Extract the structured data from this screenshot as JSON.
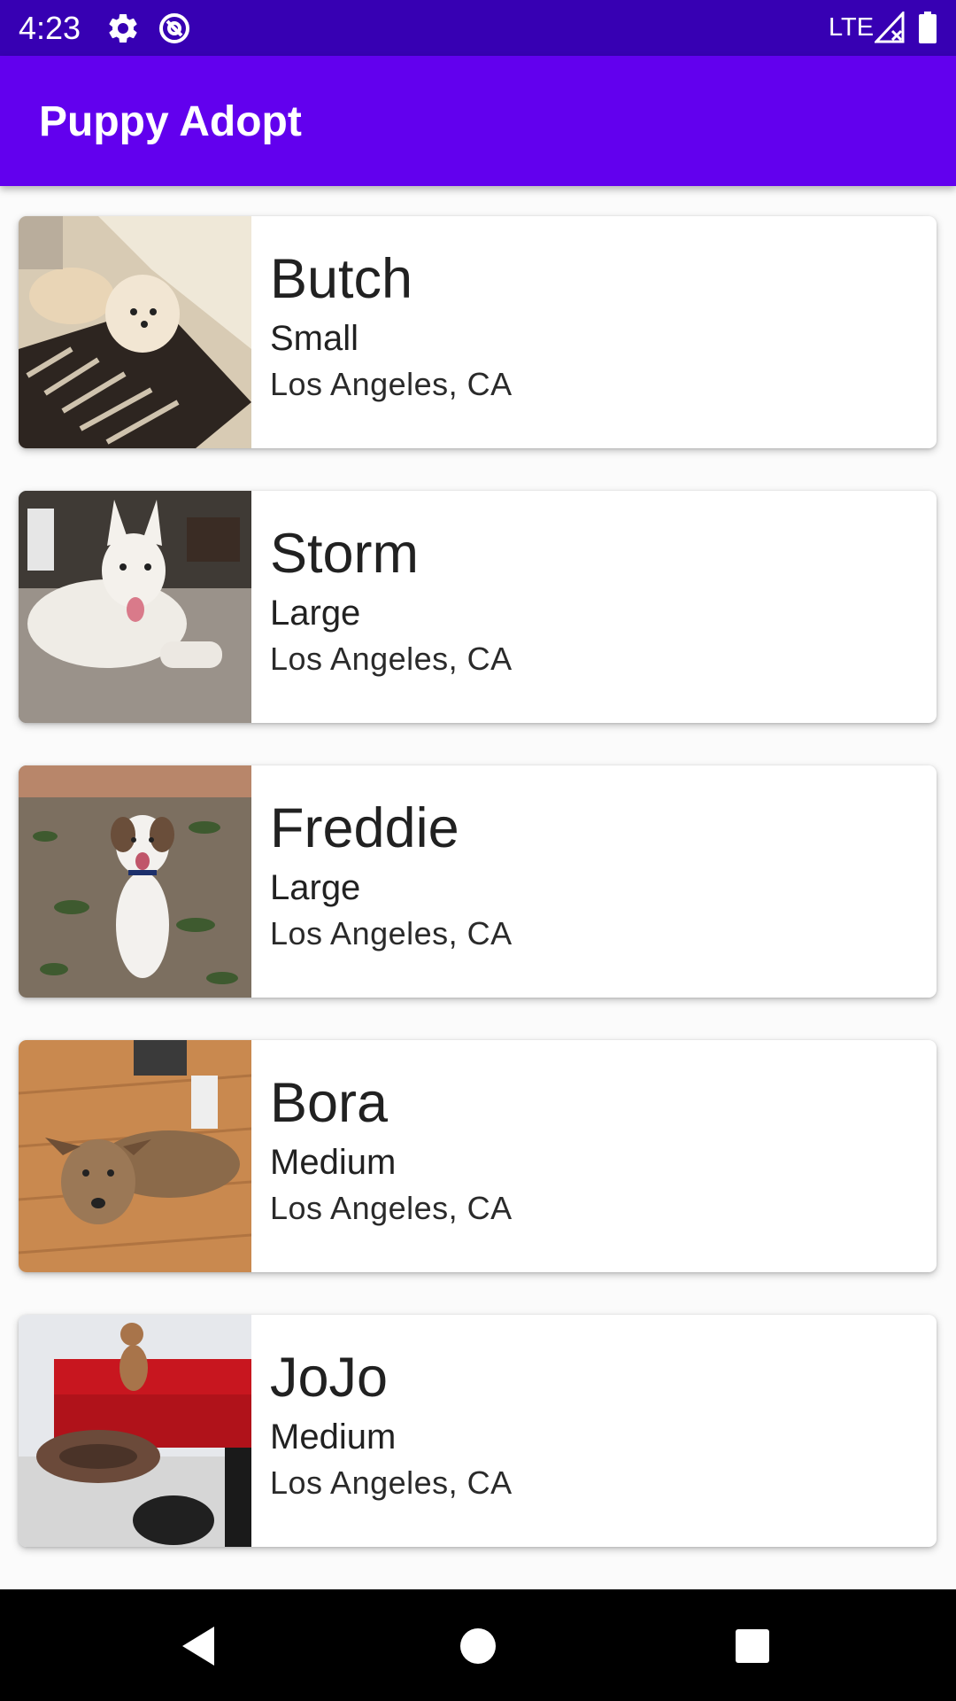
{
  "status_bar": {
    "time": "4:23",
    "network": "LTE",
    "icons": [
      "gear-icon",
      "data-saver-icon",
      "signal-icon",
      "battery-icon"
    ]
  },
  "app_bar": {
    "title": "Puppy Adopt",
    "color": "#6200ee",
    "status_color": "#3700b3"
  },
  "puppies": [
    {
      "name": "Butch",
      "size": "Small",
      "location": "Los Angeles, CA"
    },
    {
      "name": "Storm",
      "size": "Large",
      "location": "Los Angeles, CA"
    },
    {
      "name": "Freddie",
      "size": "Large",
      "location": "Los Angeles, CA"
    },
    {
      "name": "Bora",
      "size": "Medium",
      "location": "Los Angeles, CA"
    },
    {
      "name": "JoJo",
      "size": "Medium",
      "location": "Los Angeles, CA"
    }
  ],
  "nav_bar": {
    "icons": [
      "back-icon",
      "home-icon",
      "recents-icon"
    ]
  }
}
